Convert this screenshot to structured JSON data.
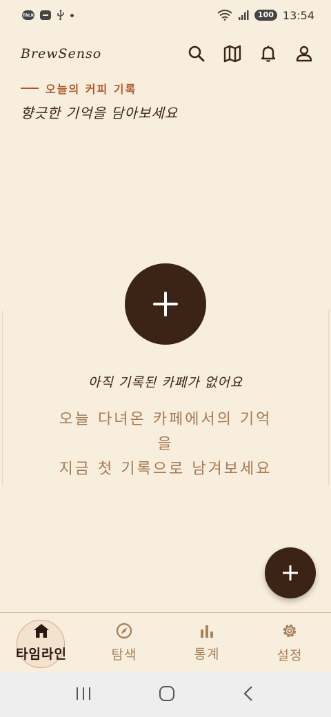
{
  "status_bar": {
    "talk_badge": "TALK",
    "battery": "100",
    "time": "13:54"
  },
  "header": {
    "brand": "BrewSenso",
    "icons": [
      "search-icon",
      "map-icon",
      "bell-icon",
      "user-icon"
    ]
  },
  "intro": {
    "eyebrow": "오늘의 커피 기록",
    "subtitle": "향긋한 기억을 담아보세요"
  },
  "empty_state": {
    "title": "아직 기록된 카페가 없어요",
    "desc_line1": "오늘 다녀온 카페에서의 기억",
    "desc_line2": "을",
    "desc_line3": "지금 첫 기록으로 남겨보세요"
  },
  "bottom_nav": {
    "items": [
      {
        "label": "타임라인",
        "icon": "home-icon",
        "active": true
      },
      {
        "label": "탐색",
        "icon": "compass-icon",
        "active": false
      },
      {
        "label": "통계",
        "icon": "bar-chart-icon",
        "active": false
      },
      {
        "label": "설정",
        "icon": "gear-icon",
        "active": false
      }
    ]
  },
  "colors": {
    "background": "#f8eedd",
    "primary": "#3b2316",
    "accent": "#b0582b",
    "muted": "#a77a55"
  }
}
